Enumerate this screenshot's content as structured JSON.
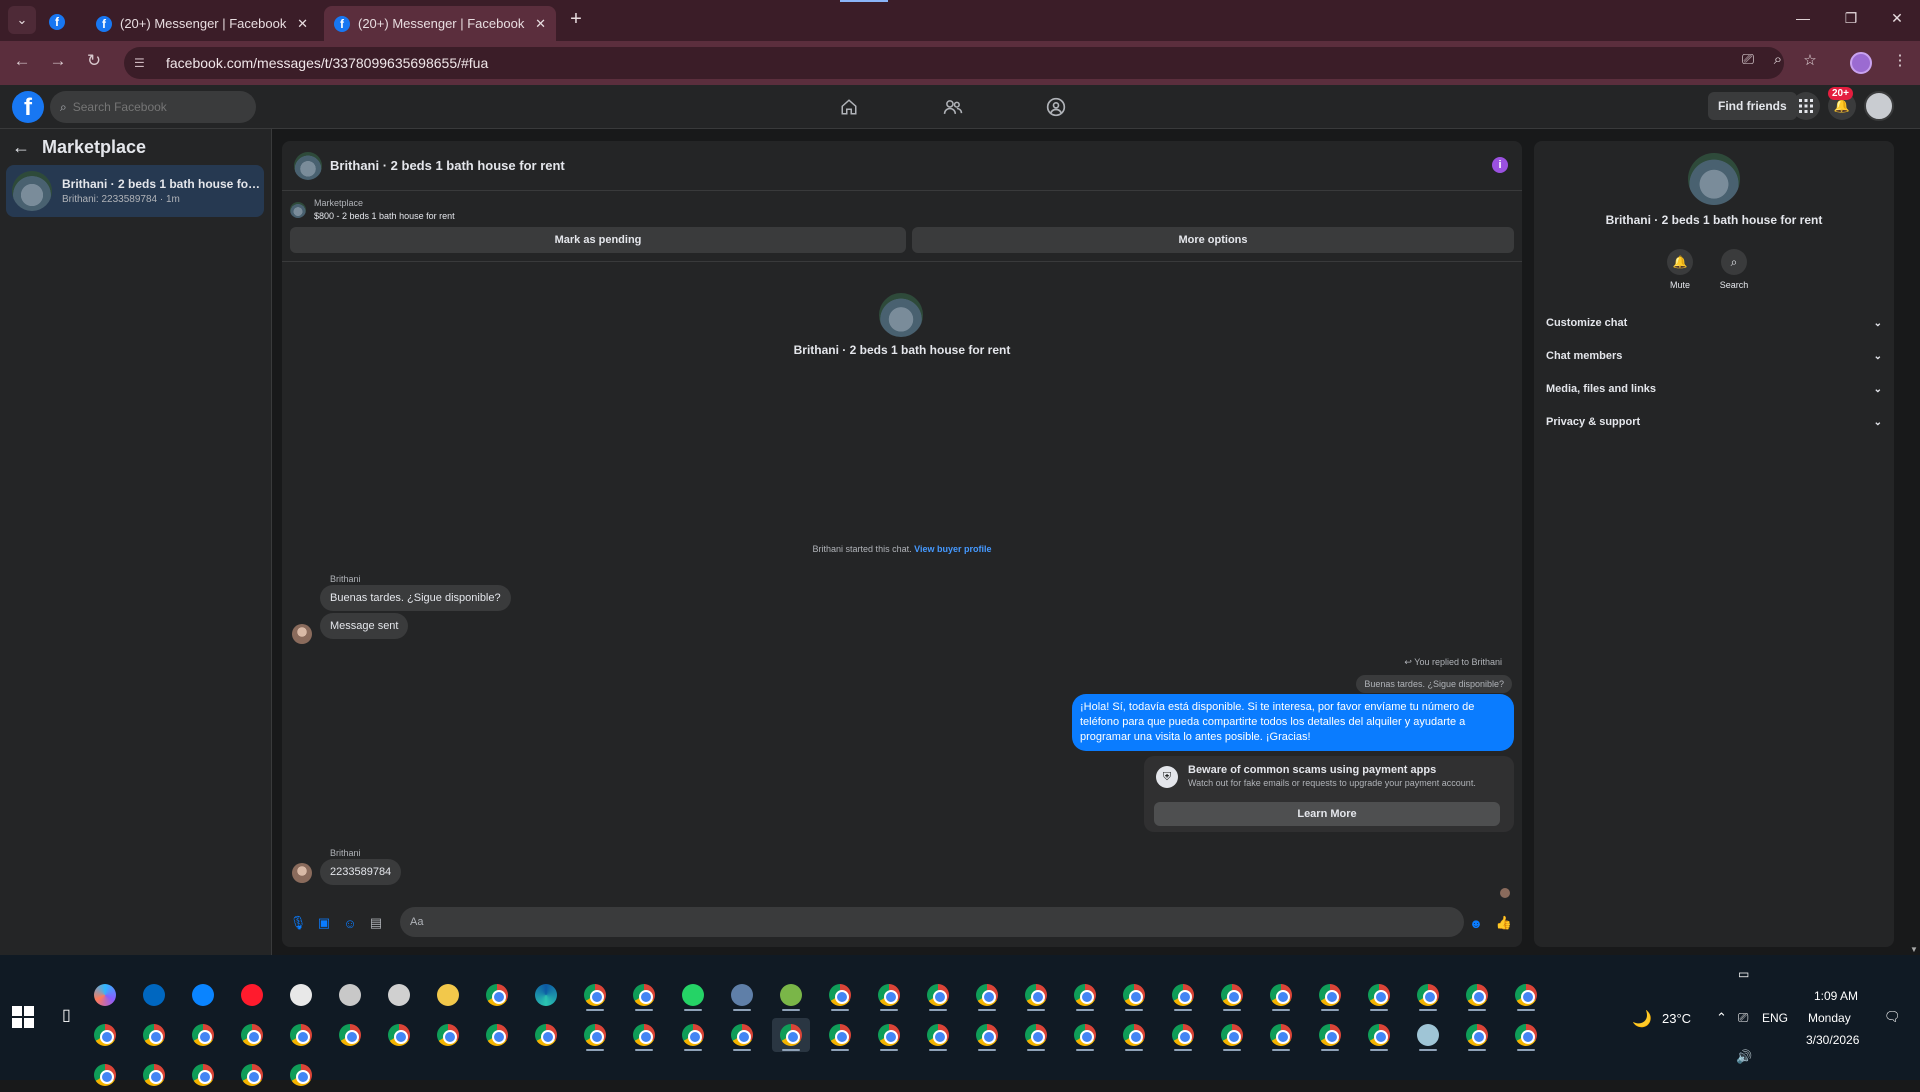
{
  "browser": {
    "tabs": [
      {
        "title": "(20+) Messenger | Facebook",
        "active": false
      },
      {
        "title": "(20+) Messenger | Facebook",
        "active": true
      }
    ],
    "url": "facebook.com/messages/t/3378099635698655/#fua"
  },
  "fb_header": {
    "search_placeholder": "Search Facebook",
    "find_friends": "Find friends",
    "notification_badge": "20+"
  },
  "sidebar": {
    "title": "Marketplace",
    "conversation": {
      "name": "Brithani · 2 beds 1 bath house for r...",
      "sub": "Brithani: 2233589784 · 1m"
    }
  },
  "chat": {
    "title": "Brithani · 2 beds 1 bath house for rent",
    "listing_label": "Marketplace",
    "listing_text": "$800 - 2 beds 1 bath house for rent",
    "mark_pending": "Mark as pending",
    "more_options": "More options",
    "center_name": "Brithani · 2 beds 1 bath house for rent",
    "started_text": "Brithani started this chat.",
    "view_buyer": "View buyer profile",
    "messages": {
      "sender1": "Brithani",
      "msg1": "Buenas tardes. ¿Sigue disponible?",
      "msg2": "Message sent",
      "replied_note": "You replied to Brithani",
      "quoted": "Buenas tardes. ¿Sigue disponible?",
      "outgoing": "¡Hola! Sí, todavía está disponible. Si te interesa, por favor envíame tu número de teléfono para que pueda compartirte todos los detalles del alquiler y ayudarte a programar una visita lo antes posible. ¡Gracias!",
      "sender2": "Brithani",
      "msg3": "2233589784"
    },
    "scam_title": "Beware of common scams using payment apps",
    "scam_desc": "Watch out for fake emails or requests to upgrade your payment account.",
    "learn_more": "Learn More",
    "composer_placeholder": "Aa"
  },
  "right_panel": {
    "name": "Brithani · 2 beds 1 bath house for rent",
    "mute": "Mute",
    "search": "Search",
    "rows": [
      "Customize chat",
      "Chat members",
      "Media, files and links",
      "Privacy & support"
    ]
  },
  "taskbar": {
    "weather": "23°C",
    "lang": "ENG",
    "time": "1:09 AM",
    "day": "Monday",
    "date": "3/30/2026"
  },
  "colors": {
    "tab_bar": "#3b1d28",
    "toolbar": "#5b2e3d",
    "fb_blue": "#1877f2",
    "bubble_blue": "#0a7cff",
    "surface": "#242526",
    "background": "#18191a"
  }
}
